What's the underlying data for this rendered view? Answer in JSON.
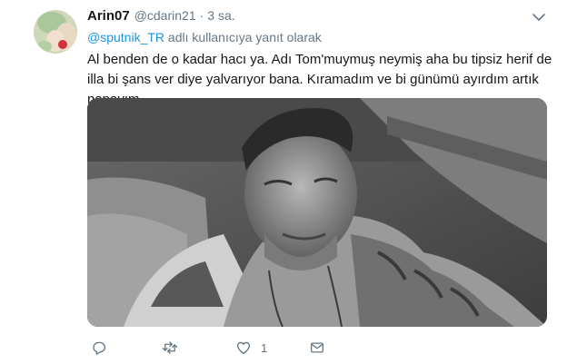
{
  "tweet": {
    "display_name": "Arin07",
    "handle": "@cdarin21",
    "separator": "·",
    "time": "3 sa.",
    "reply_mention": "@sputnik_TR",
    "reply_suffix": "adlı kullanıcıya yanıt olarak",
    "text": "Al benden de o kadar hacı ya. Adı Tom'muymuş neymiş aha bu tipsiz herif de illa bi şans ver diye yalvarıyor bana. Kıramadım ve bi günümü ayırdım artık napayım.",
    "media_description_icon": "photo",
    "actions": {
      "reply_icon": "reply-icon",
      "retweet_icon": "retweet-icon",
      "like_icon": "heart-icon",
      "like_count": "1",
      "dm_icon": "envelope-icon"
    }
  },
  "colors": {
    "text": "#14171a",
    "secondary": "#657786",
    "link": "#1b95e0"
  }
}
